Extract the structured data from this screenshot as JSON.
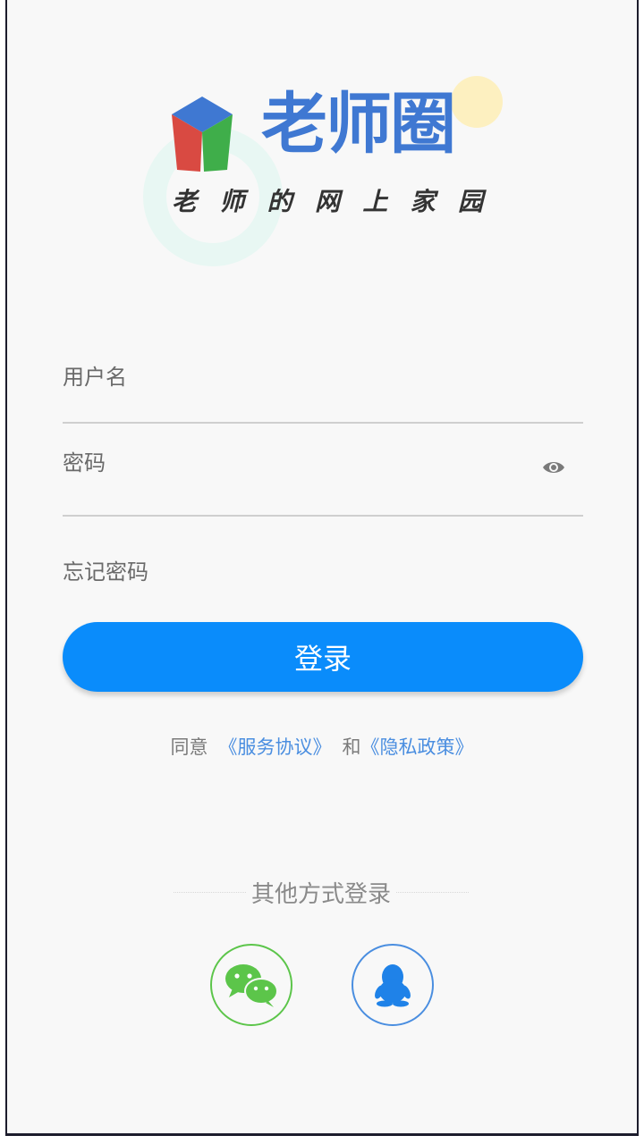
{
  "logo": {
    "title": "老师圈",
    "slogan": [
      "老",
      "师",
      "的",
      "网",
      "上",
      "家",
      "园"
    ]
  },
  "form": {
    "username_placeholder": "用户名",
    "password_placeholder": "密码",
    "forgot_password": "忘记密码",
    "login_label": "登录"
  },
  "agreement": {
    "prefix": "同意",
    "service_link": "《服务协议》",
    "and": "和",
    "privacy_link": "《隐私政策》"
  },
  "other_login": {
    "label": "其他方式登录",
    "methods": [
      {
        "name": "wechat",
        "icon": "wechat-icon",
        "color": "#5cc54a"
      },
      {
        "name": "qq",
        "icon": "qq-icon",
        "color": "#4a8ee0"
      }
    ]
  },
  "colors": {
    "primary": "#0a8cfb",
    "link": "#4a8ee0",
    "logo_blue": "#3f78d2"
  }
}
